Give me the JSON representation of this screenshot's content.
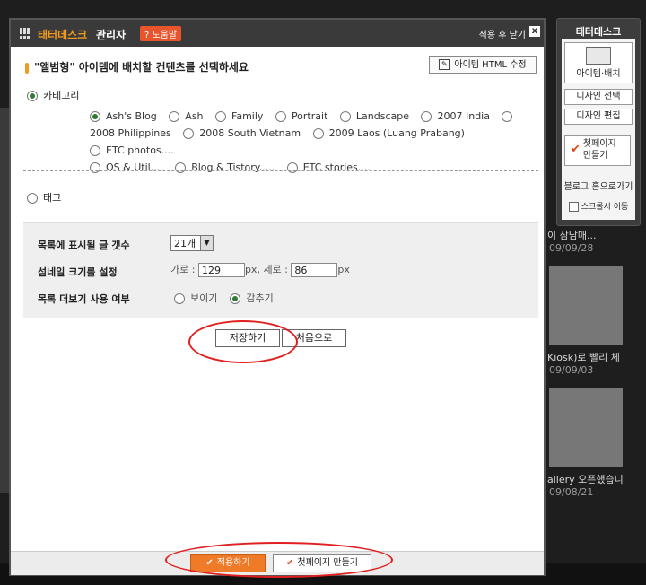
{
  "background": {
    "posts": [
      {
        "title": "이 삼남매...",
        "date": "09/09/28"
      },
      {
        "title": "Kiosk)로 빨리 체",
        "date": "09/09/03"
      },
      {
        "title": "allery 오픈했습니",
        "date": "09/08/21"
      }
    ]
  },
  "tatterdesk": {
    "title": "태터데스크",
    "item_layout": "아이템·배치",
    "design_select": "디자인 선택",
    "design_edit": "디자인 편집",
    "first_page_line1": "첫페이지",
    "first_page_line2": "만들기",
    "blog_home": "블로그 홈으로가기",
    "scroll_move": "스크롤시 이동"
  },
  "dialog": {
    "title_brand": "태터데스크",
    "title_suffix": "관리자",
    "help_badge": "? 도움말",
    "close_label": "적용 후 닫기",
    "close_x": "x",
    "section_title": "\"앨범형\" 아이템에 배치할 컨텐츠를 선택하세요",
    "html_edit_button": "아이템 HTML 수정",
    "category_label": "카테고리",
    "categories": [
      {
        "label": "Ash's Blog",
        "selected": true
      },
      {
        "label": "Ash",
        "selected": false
      },
      {
        "label": "Family",
        "selected": false
      },
      {
        "label": "Portrait",
        "selected": false
      },
      {
        "label": "Landscape",
        "selected": false
      },
      {
        "label": "2007 India",
        "selected": false
      },
      {
        "label": "2008 Philippines",
        "selected": false
      },
      {
        "label": "2008 South Vietnam",
        "selected": false
      },
      {
        "label": "2009 Laos (Luang Prabang)",
        "selected": false
      },
      {
        "label": "ETC photos....",
        "selected": false
      },
      {
        "label": "OS & Util....",
        "selected": false
      },
      {
        "label": "Blog & Tistory.....",
        "selected": false
      },
      {
        "label": "ETC stories....",
        "selected": false
      }
    ],
    "tag_label": "태그",
    "options": {
      "count_label": "목록에 표시될 글 갯수",
      "count_value": "21개",
      "thumb_label": "섬네일 크기를 설정",
      "thumb_width_label": "가로 :",
      "thumb_width": "129",
      "thumb_unit1": "px, 세로 :",
      "thumb_height": "86",
      "thumb_unit2": "px",
      "more_label": "목록 더보기 사용 여부",
      "more_show": "보이기",
      "more_hide": "감추기",
      "more_selected": "감추기"
    },
    "save_button": "저장하기",
    "reset_button": "처음으로",
    "apply_button": "적용하기",
    "first_page_button": "첫페이지 만들기"
  }
}
